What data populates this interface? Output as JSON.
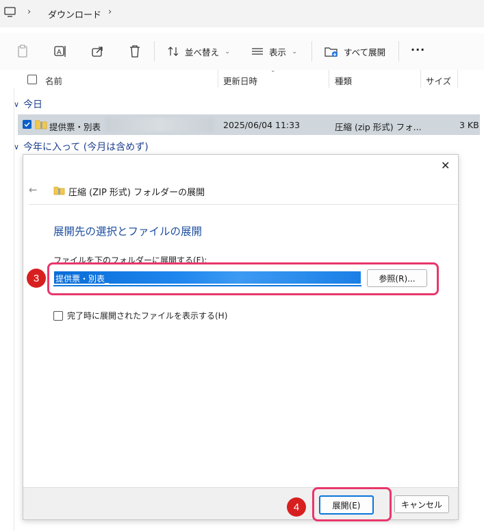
{
  "address": {
    "crumb": "ダウンロード"
  },
  "toolbar": {
    "sort_label": "並べ替え",
    "view_label": "表示",
    "extract_all_label": "すべて展開",
    "more_label": "···"
  },
  "columns": {
    "name": "名前",
    "modified": "更新日時",
    "type": "種類",
    "size": "サイズ"
  },
  "groups": {
    "today": "今日",
    "this_year": "今年に入って (今月は含めず)"
  },
  "file_row": {
    "name": "提供票・別表",
    "modified": "2025/06/04 11:33",
    "type": "圧縮 (zip 形式) フォ...",
    "size": "3 KB"
  },
  "dialog": {
    "title": "圧縮 (ZIP 形式) フォルダーの展開",
    "heading": "展開先の選択とファイルの展開",
    "field_label": "ファイルを下のフォルダーに展開する(F):",
    "path_value": "提供票・別表_",
    "browse_label": "参照(R)...",
    "show_files_label": "完了時に展開されたファイルを表示する(H)",
    "extract_label": "展開(E)",
    "cancel_label": "キャンセル"
  },
  "annotations": {
    "step3": "3",
    "step4": "4"
  },
  "colors": {
    "highlight": "#e8366b",
    "badge": "#d81f1f",
    "selection": "#0a74da"
  }
}
